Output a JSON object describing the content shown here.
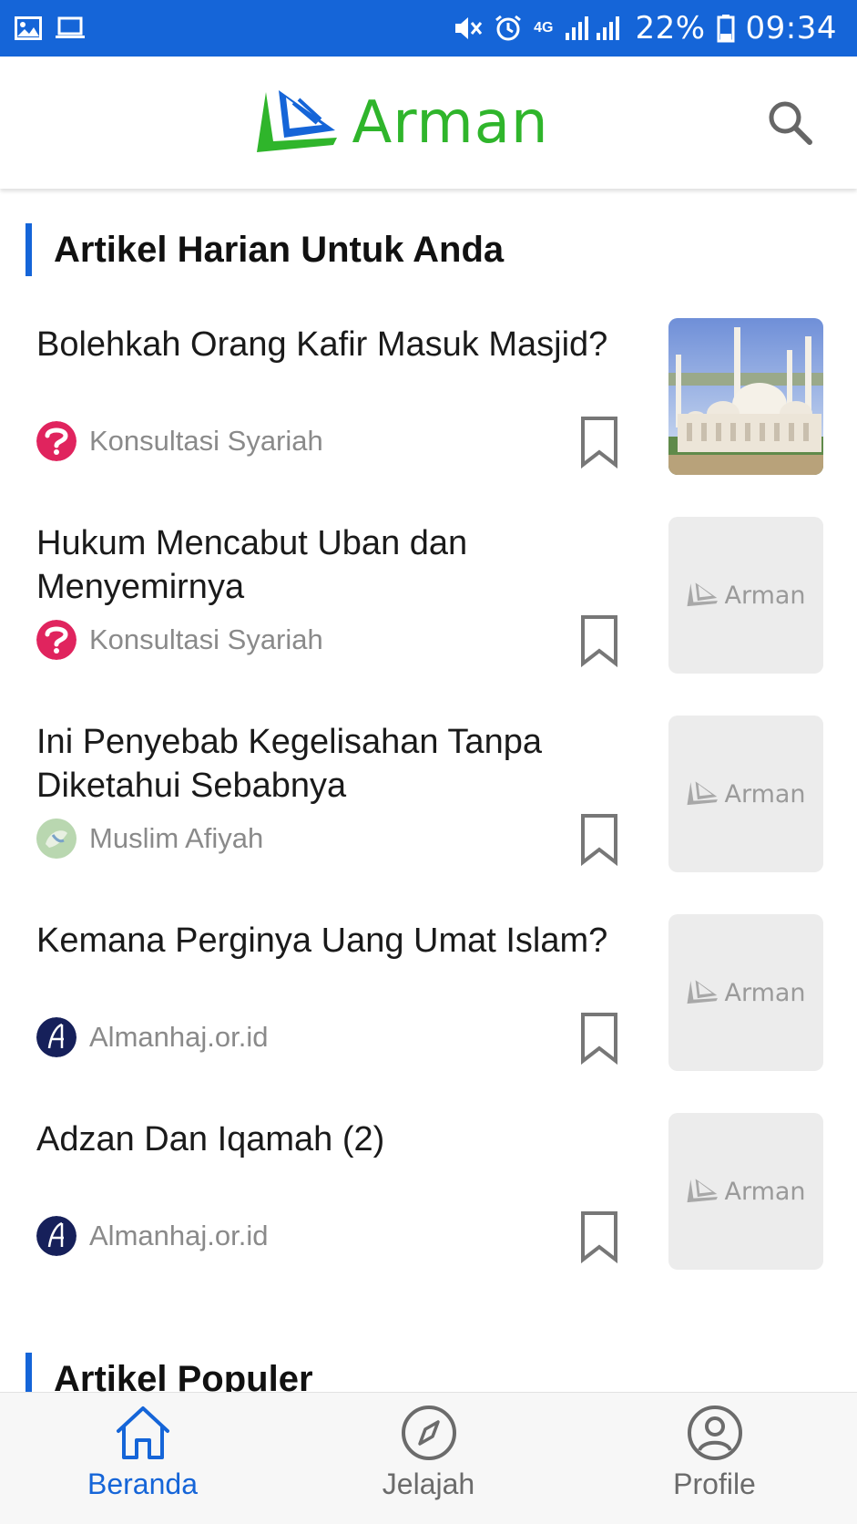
{
  "status_bar": {
    "network_type": "4G",
    "battery": "22%",
    "time": "09:34",
    "icons": [
      "gallery-icon",
      "laptop-icon",
      "mute-icon",
      "alarm-icon",
      "signal-icon",
      "battery-icon"
    ]
  },
  "header": {
    "brand": "Arman",
    "logo_icon": "arman-logo-icon",
    "search_icon": "search-icon"
  },
  "colors": {
    "primary": "#1565d8",
    "brand_green": "#2fb52b",
    "muted_text": "#8a8a8a"
  },
  "sections": {
    "daily": {
      "title": "Artikel Harian Untuk Anda"
    },
    "popular": {
      "title": "Artikel Populer"
    }
  },
  "articles": [
    {
      "title": "Bolehkah Orang Kafir Masuk Masjid?",
      "source": "Konsultasi Syariah",
      "thumb": "mosque-photo"
    },
    {
      "title": "Hukum Mencabut Uban dan Menyemirnya",
      "source": "Konsultasi Syariah",
      "thumb": "placeholder",
      "thumb_label": "Arman"
    },
    {
      "title": "Ini Penyebab Kegelisahan Tanpa Diketahui Sebabnya",
      "source": "Muslim Afiyah",
      "thumb": "placeholder",
      "thumb_label": "Arman"
    },
    {
      "title": "Kemana Perginya Uang Umat Islam?",
      "source": "Almanhaj.or.id",
      "thumb": "placeholder",
      "thumb_label": "Arman"
    },
    {
      "title": "Adzan Dan Iqamah (2)",
      "source": "Almanhaj.or.id",
      "thumb": "placeholder",
      "thumb_label": "Arman"
    }
  ],
  "bottom_nav": [
    {
      "label": "Beranda",
      "icon": "home-icon",
      "active": true
    },
    {
      "label": "Jelajah",
      "icon": "compass-icon",
      "active": false
    },
    {
      "label": "Profile",
      "icon": "profile-icon",
      "active": false
    }
  ]
}
